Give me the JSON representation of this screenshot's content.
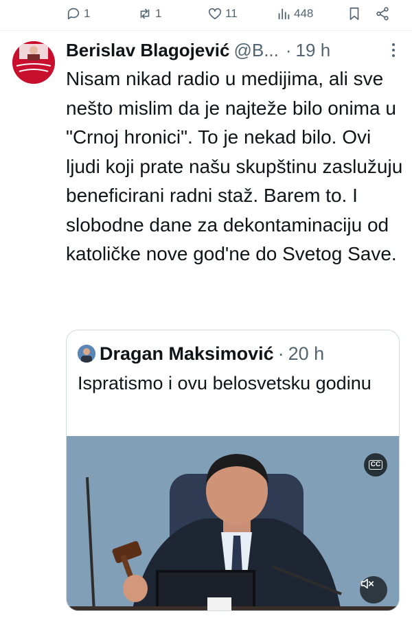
{
  "action_bar": {
    "replies": "1",
    "reposts": "1",
    "likes": "11",
    "views": "448"
  },
  "tweet": {
    "display_name": "Berislav Blagojević",
    "handle": "@B...",
    "separator": "·",
    "time": "19 h",
    "text": "Nisam nikad radio u medijima, ali sve nešto mislim da je najteže bilo onima u \"Crnoj hronici\". To je nekad bilo. Ovi ljudi koji prate našu skupštinu zaslužuju beneficirani radni staž. Barem to. I slobodne dane za dekontaminaciju od katoličke nove god'ne do Svetog Save."
  },
  "quoted_tweet": {
    "display_name": "Dragan Maksimović",
    "separator": "·",
    "time": "20 h",
    "text": "Ispratismo i ovu belosvetsku godinu",
    "media": {
      "type": "video",
      "cc_label": "CC"
    }
  },
  "colors": {
    "text_primary": "#0f1419",
    "text_secondary": "#536471",
    "border": "#cfd9de"
  }
}
